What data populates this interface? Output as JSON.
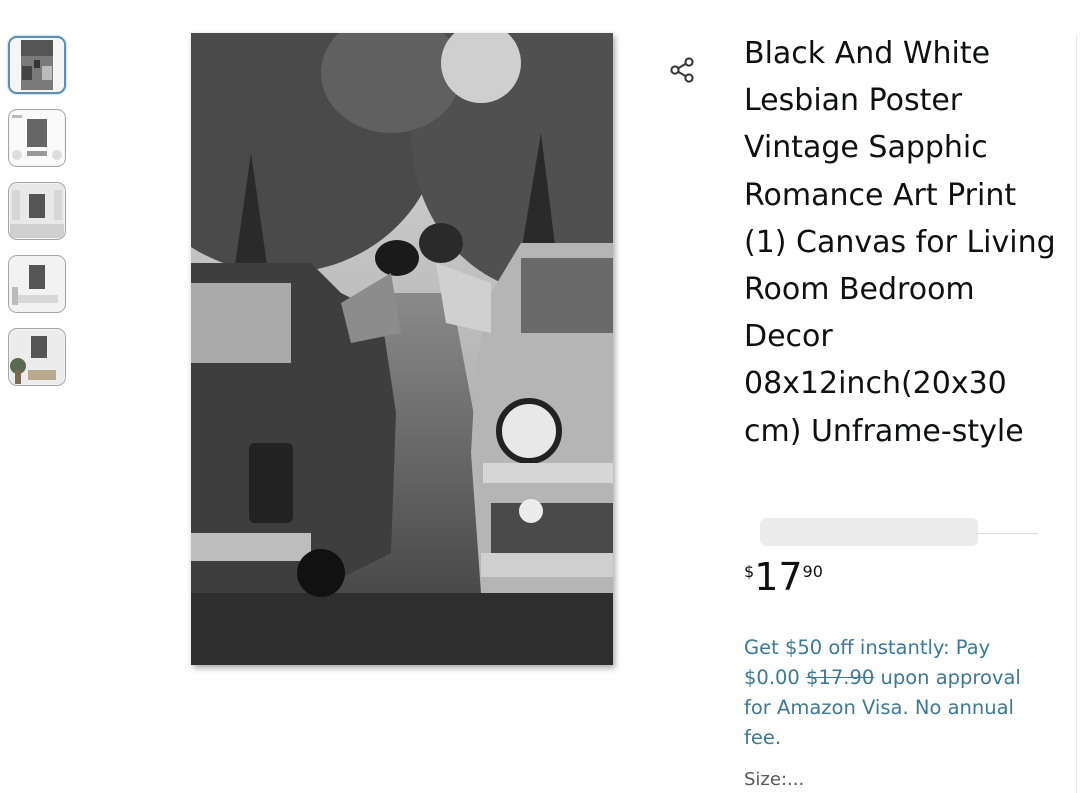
{
  "thumbnails": [
    {
      "icon": "poster-photo-thumbnail",
      "selected": true
    },
    {
      "icon": "poster-dimensions-thumbnail",
      "selected": false
    },
    {
      "icon": "poster-room-thumbnail",
      "selected": false
    },
    {
      "icon": "poster-wall-thumbnail",
      "selected": false
    },
    {
      "icon": "poster-living-room-thumbnail",
      "selected": false
    }
  ],
  "main_image": {
    "icon": "black-white-kiss-between-cars-photo"
  },
  "share": {
    "icon": "share-icon"
  },
  "product": {
    "title": "Black And White Lesbian Poster Vintage Sapphic Romance Art Print (1) Canvas for Living Room Bedroom Decor 08x12inch(20x30 cm) Unframe-style"
  },
  "price": {
    "symbol": "$",
    "whole": "17",
    "fraction": "90"
  },
  "promo": {
    "lead": "Get $50 off instantly: Pay $0.00",
    "struck": "$17.90",
    "tail": "upon approval for Amazon Visa. No annual fee."
  },
  "size": {
    "label": "Size:..."
  },
  "colors": {
    "link": "#3b7a96",
    "selected_border": "#5e8fb1",
    "text": "#0f1111"
  }
}
